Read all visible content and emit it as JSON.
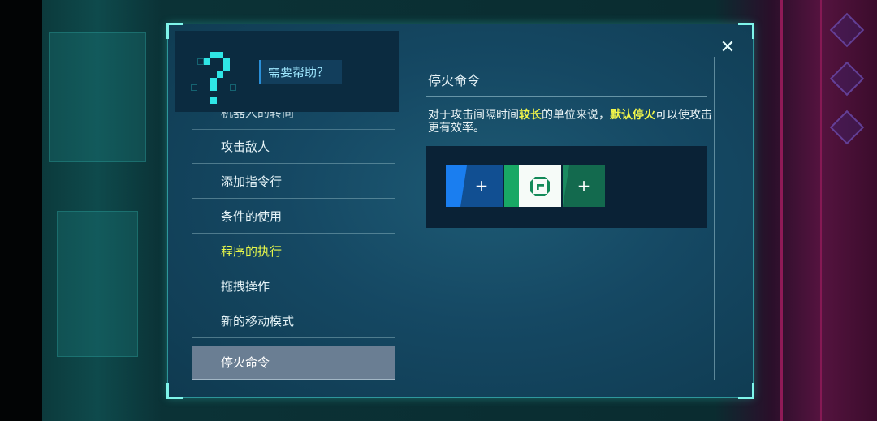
{
  "help": {
    "title": "需要帮助？",
    "close_label": "✕"
  },
  "topics": [
    {
      "label": "机器人的转向"
    },
    {
      "label": "攻击敌人"
    },
    {
      "label": "添加指令行"
    },
    {
      "label": "条件的使用"
    },
    {
      "label": "程序的执行"
    },
    {
      "label": "拖拽操作"
    },
    {
      "label": "新的移动模式"
    },
    {
      "label": "停火命令"
    }
  ],
  "selected_topic": "停火命令",
  "highlighted_topic": "程序的执行",
  "content": {
    "title": "停火命令",
    "desc_part1": "对于攻击间隔时间",
    "desc_hl1": "较长",
    "desc_part2": "的单位来说，",
    "desc_hl2": "默认停火",
    "desc_part3": "可以使攻击更有效率。"
  },
  "demo": {
    "plus_label": "+",
    "icon": "cease-fire-icon"
  },
  "colors": {
    "accent": "#7ff5ea",
    "highlight": "#f2f64a",
    "selected_bg": "#6a7e93",
    "blue": "#1a7ef0",
    "green": "#19a865"
  }
}
